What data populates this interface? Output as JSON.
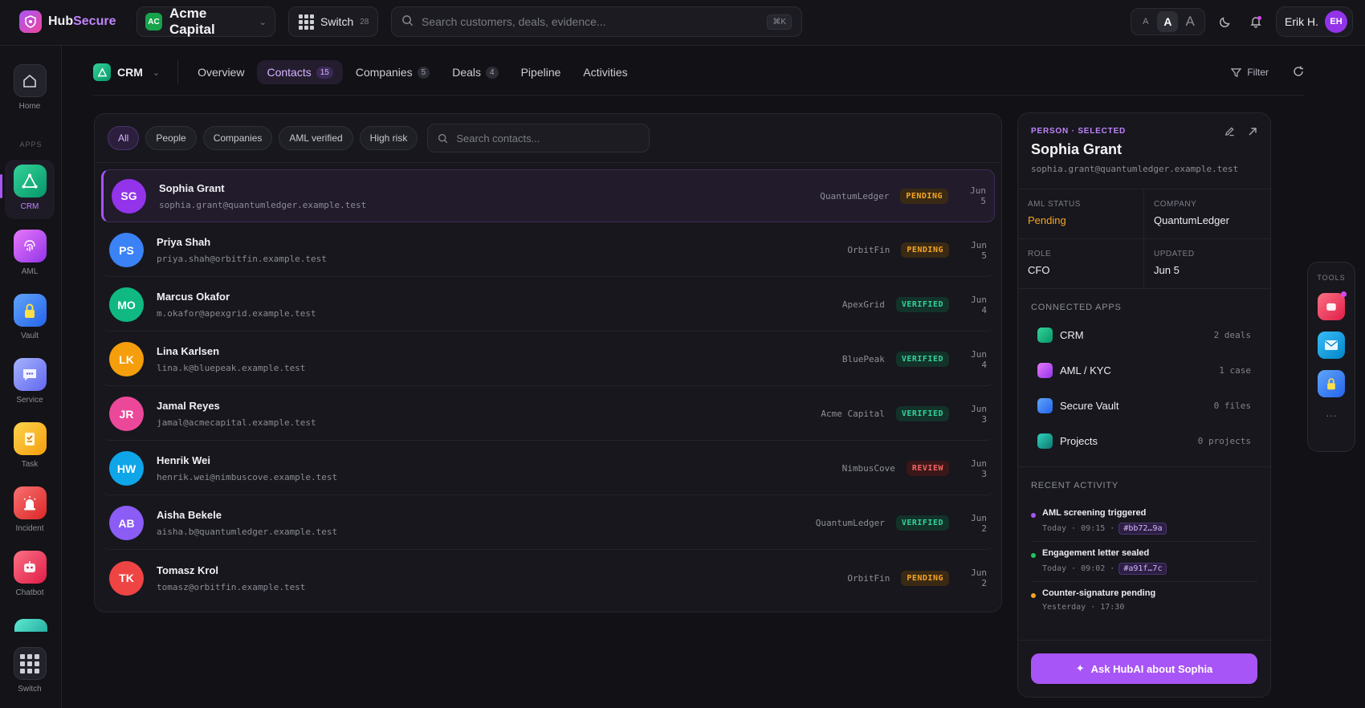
{
  "brand": {
    "name_prefix": "Hub",
    "name_suffix": "Secure"
  },
  "org": {
    "initials": "AC",
    "name": "Acme Capital"
  },
  "switcher": {
    "label": "Switch",
    "count": "28"
  },
  "search": {
    "placeholder": "Search customers, deals, evidence...",
    "shortcut": "⌘K"
  },
  "font_sizes": {
    "small": "A",
    "medium": "A",
    "large": "A"
  },
  "user": {
    "name": "Erik H.",
    "initials": "EH"
  },
  "rail": {
    "home": "Home",
    "section": "APPS",
    "apps": [
      {
        "label": "CRM",
        "icon": "crm-icon"
      },
      {
        "label": "AML",
        "icon": "fingerprint-icon"
      },
      {
        "label": "Vault",
        "icon": "lock-icon"
      },
      {
        "label": "Service",
        "icon": "chat-bubble-icon"
      },
      {
        "label": "Task",
        "icon": "checklist-icon"
      },
      {
        "label": "Incident",
        "icon": "alarm-icon"
      },
      {
        "label": "Chatbot",
        "icon": "chatbot-icon"
      }
    ],
    "switch": "Switch"
  },
  "subnav": {
    "app": "CRM",
    "tabs": [
      {
        "label": "Overview",
        "count": ""
      },
      {
        "label": "Contacts",
        "count": "15"
      },
      {
        "label": "Companies",
        "count": "5"
      },
      {
        "label": "Deals",
        "count": "4"
      },
      {
        "label": "Pipeline",
        "count": ""
      },
      {
        "label": "Activities",
        "count": ""
      }
    ],
    "filter": "Filter"
  },
  "filters": {
    "chips": [
      "All",
      "People",
      "Companies",
      "AML verified",
      "High risk"
    ],
    "search_placeholder": "Search contacts..."
  },
  "contacts": [
    {
      "initials": "SG",
      "name": "Sophia Grant",
      "email": "sophia.grant@quantumledger.example.test",
      "company": "QuantumLedger",
      "status": "PENDING",
      "date": "Jun 5",
      "color": "#9333ea"
    },
    {
      "initials": "PS",
      "name": "Priya Shah",
      "email": "priya.shah@orbitfin.example.test",
      "company": "OrbitFin",
      "status": "PENDING",
      "date": "Jun 5",
      "color": "#3b82f6"
    },
    {
      "initials": "MO",
      "name": "Marcus Okafor",
      "email": "m.okafor@apexgrid.example.test",
      "company": "ApexGrid",
      "status": "VERIFIED",
      "date": "Jun 4",
      "color": "#10b981"
    },
    {
      "initials": "LK",
      "name": "Lina Karlsen",
      "email": "lina.k@bluepeak.example.test",
      "company": "BluePeak",
      "status": "VERIFIED",
      "date": "Jun 4",
      "color": "#f59e0b"
    },
    {
      "initials": "JR",
      "name": "Jamal Reyes",
      "email": "jamal@acmecapital.example.test",
      "company": "Acme Capital",
      "status": "VERIFIED",
      "date": "Jun 3",
      "color": "#ec4899"
    },
    {
      "initials": "HW",
      "name": "Henrik Wei",
      "email": "henrik.wei@nimbuscove.example.test",
      "company": "NimbusCove",
      "status": "REVIEW",
      "date": "Jun 3",
      "color": "#0ea5e9"
    },
    {
      "initials": "AB",
      "name": "Aisha Bekele",
      "email": "aisha.b@quantumledger.example.test",
      "company": "QuantumLedger",
      "status": "VERIFIED",
      "date": "Jun 2",
      "color": "#8b5cf6"
    },
    {
      "initials": "TK",
      "name": "Tomasz Krol",
      "email": "tomasz@orbitfin.example.test",
      "company": "OrbitFin",
      "status": "PENDING",
      "date": "Jun 2",
      "color": "#ef4444"
    }
  ],
  "detail": {
    "eyebrow": "PERSON · SELECTED",
    "name": "Sophia Grant",
    "email": "sophia.grant@quantumledger.example.test",
    "facts": [
      {
        "label": "AML STATUS",
        "value": "Pending"
      },
      {
        "label": "COMPANY",
        "value": "QuantumLedger"
      },
      {
        "label": "ROLE",
        "value": "CFO"
      },
      {
        "label": "UPDATED",
        "value": "Jun 5"
      }
    ],
    "connected_title": "CONNECTED APPS",
    "connected": [
      {
        "name": "CRM",
        "meta": "2 deals"
      },
      {
        "name": "AML / KYC",
        "meta": "1 case"
      },
      {
        "name": "Secure Vault",
        "meta": "0 files"
      },
      {
        "name": "Projects",
        "meta": "0 projects"
      }
    ],
    "activity_title": "RECENT ACTIVITY",
    "activity": [
      {
        "title": "AML screening triggered",
        "time": "Today · 09:15 ·",
        "hash": "#bb72…9a",
        "color": "#a855f7"
      },
      {
        "title": "Engagement letter sealed",
        "time": "Today · 09:02 ·",
        "hash": "#a91f…7c",
        "color": "#22c55e"
      },
      {
        "title": "Counter-signature pending",
        "time": "Yesterday · 17:30",
        "hash": "",
        "color": "#f5a524"
      }
    ],
    "ask_button": "Ask HubAI about Sophia"
  },
  "tools": {
    "label": "TOOLS",
    "more": "···"
  }
}
